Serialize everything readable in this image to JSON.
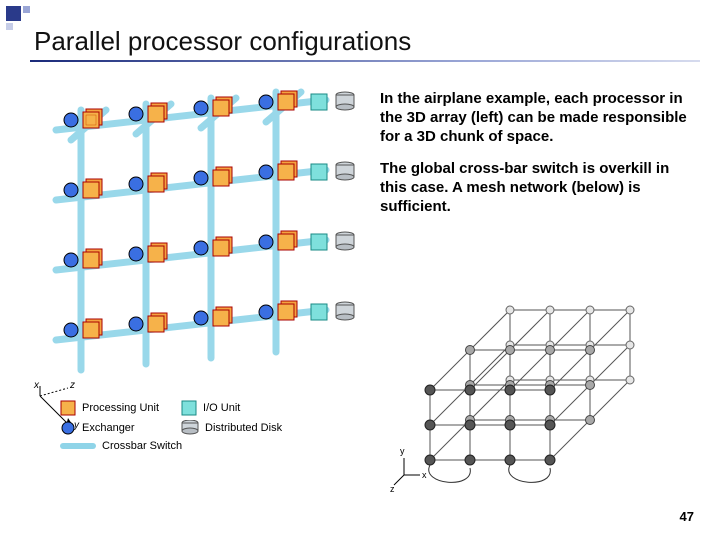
{
  "corner": {
    "accent": "#2a3a8a"
  },
  "title": "Parallel processor configurations",
  "paragraphs": {
    "p1": "In the airplane example, each processor in the 3D array (left) can be made responsible for a 3D chunk of space.",
    "p2": "The global cross-bar switch is overkill in this case.  A mesh network (below) is sufficient."
  },
  "legend": {
    "processing_unit": "Processing Unit",
    "io_unit": "I/O Unit",
    "exchanger": "Exchanger",
    "distributed_disk": "Distributed Disk",
    "crossbar_switch": "Crossbar Switch"
  },
  "axes_left": {
    "x": "x",
    "y": "y",
    "z": "z"
  },
  "axes_right": {
    "x": "x",
    "y": "y",
    "z": "z"
  },
  "page_number": "47",
  "figure_left": {
    "rows": 4,
    "cols": 4,
    "has_processing": true,
    "has_exchanger": true,
    "has_io_per_row": true,
    "has_disk_per_row": true
  },
  "figure_right": {
    "type": "3d_mesh",
    "nx": 4,
    "ny": 3,
    "nz": 3
  }
}
